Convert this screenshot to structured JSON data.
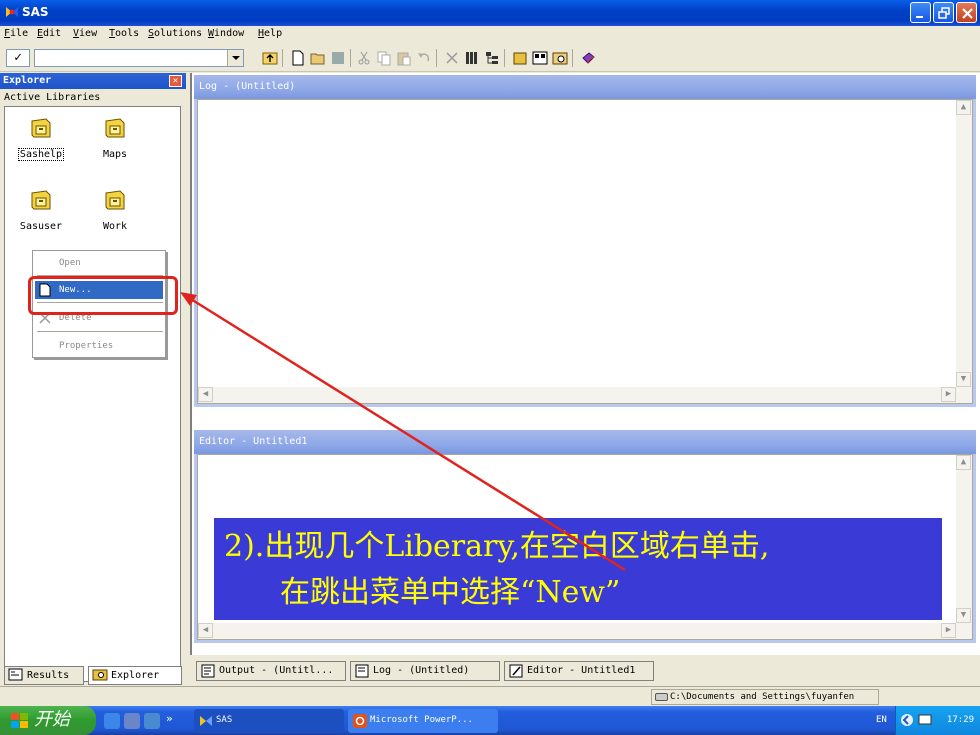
{
  "title_bar": {
    "title": "SAS"
  },
  "menu": [
    {
      "label": "File",
      "hotkey": "F",
      "rest": "ile"
    },
    {
      "label": "Edit",
      "hotkey": "E",
      "rest": "dit"
    },
    {
      "label": "View",
      "hotkey": "V",
      "rest": "iew"
    },
    {
      "label": "Tools",
      "hotkey": "T",
      "rest": "ools"
    },
    {
      "label": "Solutions",
      "hotkey": "S",
      "rest": "olutions"
    },
    {
      "label": "Window",
      "hotkey": "W",
      "rest": "indow"
    },
    {
      "label": "Help",
      "hotkey": "H",
      "rest": "elp"
    }
  ],
  "toolbar": {
    "command_check": "✓",
    "command_value": ""
  },
  "explorer": {
    "title": "Explorer",
    "close_glyph": "✕",
    "subheader": "Active Libraries",
    "libraries": [
      {
        "label": "Sashelp",
        "selected": true
      },
      {
        "label": "Maps",
        "selected": false
      },
      {
        "label": "Sasuser",
        "selected": false
      },
      {
        "label": "Work",
        "selected": false
      }
    ],
    "context_menu": {
      "open": "Open",
      "new": "New...",
      "delete": "Delete",
      "properties": "Properties"
    },
    "tabs": {
      "results": "Results",
      "explorer": "Explorer"
    }
  },
  "log_window": {
    "title": "Log - (Untitled)"
  },
  "editor_window": {
    "title": "Editor - Untitled1"
  },
  "overlay": {
    "line1": "2).出现几个Liberary,在空白区域右单击,",
    "line2": "在跳出菜单中选择“New”",
    "background_color": "#3a3ad6",
    "text_color": "#ffff00",
    "arrow_color": "#e0231c"
  },
  "window_tabs": {
    "output": "Output - (Untitl...",
    "log": "Log - (Untitled)",
    "editor": "Editor - Untitled1"
  },
  "status_bar": {
    "path": "C:\\Documents and Settings\\fuyanfen"
  },
  "taskbar": {
    "start_label": "开始",
    "chevron": "»",
    "tasks": {
      "sas": "SAS",
      "powerpoint": "Microsoft PowerP..."
    },
    "language": "EN",
    "clock": "17:29"
  }
}
